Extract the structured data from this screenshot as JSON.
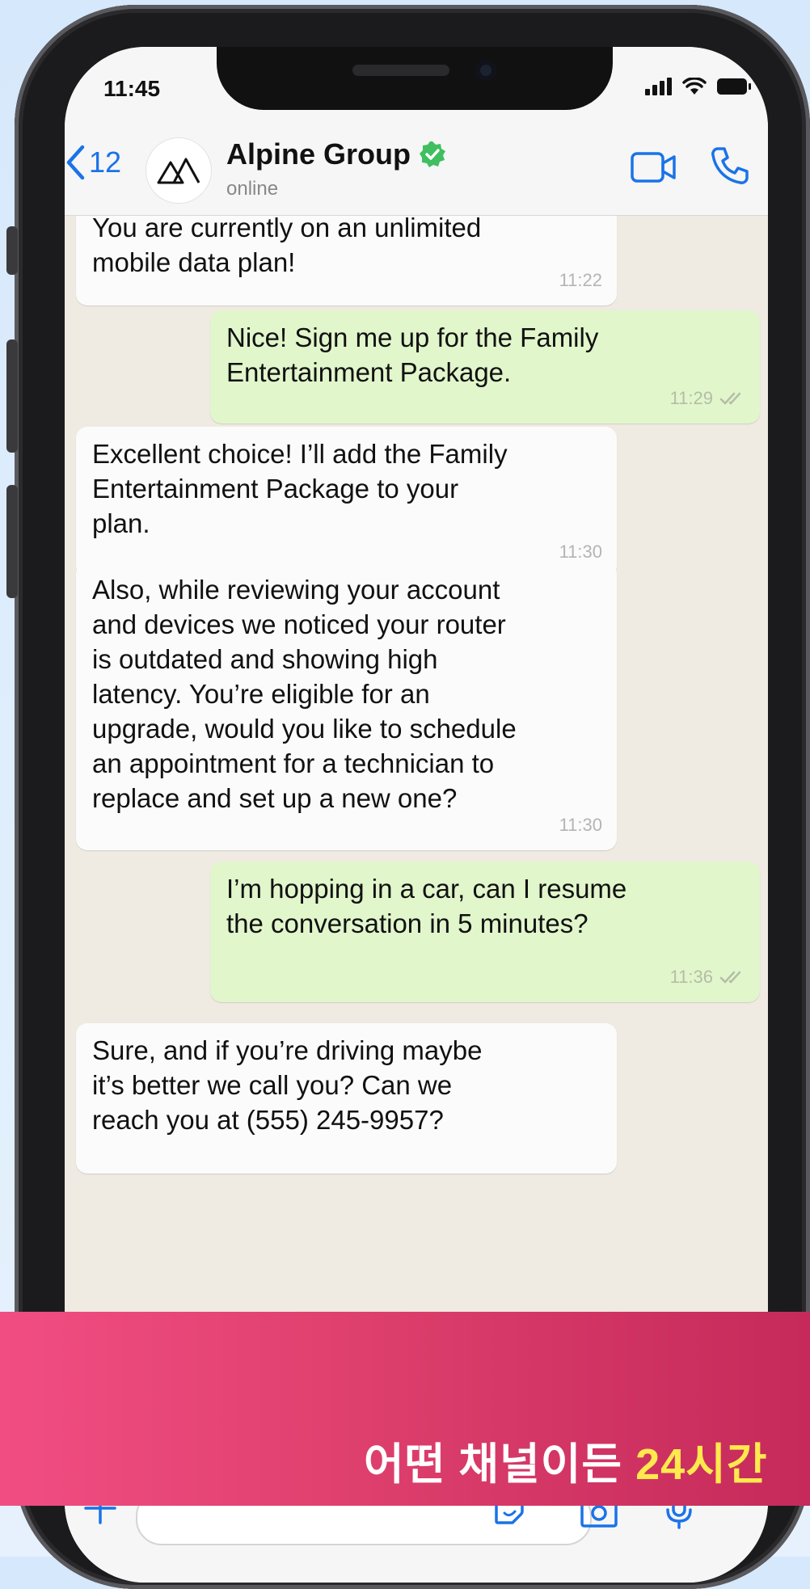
{
  "status_bar": {
    "time": "11:45"
  },
  "header": {
    "back_count": "12",
    "contact_name": "Alpine Group",
    "contact_status": "online"
  },
  "messages": [
    {
      "direction": "incoming",
      "text": "You are currently on an unlimited\nmobile data plan!",
      "time": "11:22"
    },
    {
      "direction": "outgoing",
      "text": "Nice! Sign me up for the Family\nEntertainment Package.",
      "time": "11:29"
    },
    {
      "direction": "incoming",
      "text": "Excellent choice! I’ll add the Family\nEntertainment Package to your\nplan.",
      "time": "11:30"
    },
    {
      "direction": "incoming",
      "text": "Also, while reviewing your account\nand devices we noticed your router\nis outdated and showing high\nlatency. You’re eligible for an\nupgrade, would you like to schedule\nan appointment for a technician to\nreplace and set up a new one?",
      "time": "11:30"
    },
    {
      "direction": "outgoing",
      "text": "I’m hopping in a car, can I resume\nthe conversation in 5 minutes?",
      "time": "11:36"
    },
    {
      "direction": "incoming",
      "text": "Sure, and if you’re driving maybe\nit’s better we call you? Can we\nreach you at (555) 245-9957?",
      "time": ""
    }
  ],
  "banner": {
    "text_main": "어떤 채널이든 ",
    "text_accent": "24",
    "text_end": "시간",
    "colors": {
      "accent": "#ffe94d",
      "gradient_start": "#f14d83",
      "gradient_end": "#c52a5a"
    }
  },
  "icons": {
    "back": "chevron-left-icon",
    "verified": "verified-badge-icon",
    "video": "video-call-icon",
    "phone": "phone-call-icon",
    "read_receipt": "double-check-icon",
    "plus": "plus-icon",
    "sticker": "sticker-icon",
    "camera": "camera-icon",
    "mic": "microphone-icon"
  },
  "colors": {
    "link_blue": "#1a73e8",
    "verified_green": "#3fbf5f",
    "outgoing_bubble": "#e1f6cb",
    "incoming_bubble": "#fbfbfb"
  }
}
